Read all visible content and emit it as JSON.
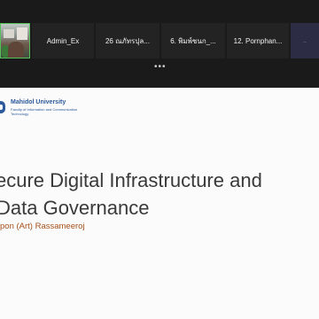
{
  "participants": [
    {
      "name": "",
      "type": "video"
    },
    {
      "name": "Admin_Ex",
      "type": "name"
    },
    {
      "name": "26 ณภัทรปุล...",
      "type": "name"
    },
    {
      "name": "6. พิมพ์ชนก_...",
      "type": "name"
    },
    {
      "name": "12. Pornphan...",
      "type": "name"
    },
    {
      "name": "...",
      "type": "tiny"
    }
  ],
  "more_indicator": "•••",
  "slide": {
    "logo_name": "Mahidol University",
    "logo_subtitle": "Faculty of Information and Communication Technology",
    "title_line1": "ecure Digital Infrastructure and",
    "title_line2": "Data Governance",
    "presenter": "pon (Art) Rassameeroj"
  },
  "colors": {
    "active_speaker_border": "#54c15a",
    "brand_blue": "#2d5a9a",
    "presenter_orange": "#a5501a"
  }
}
